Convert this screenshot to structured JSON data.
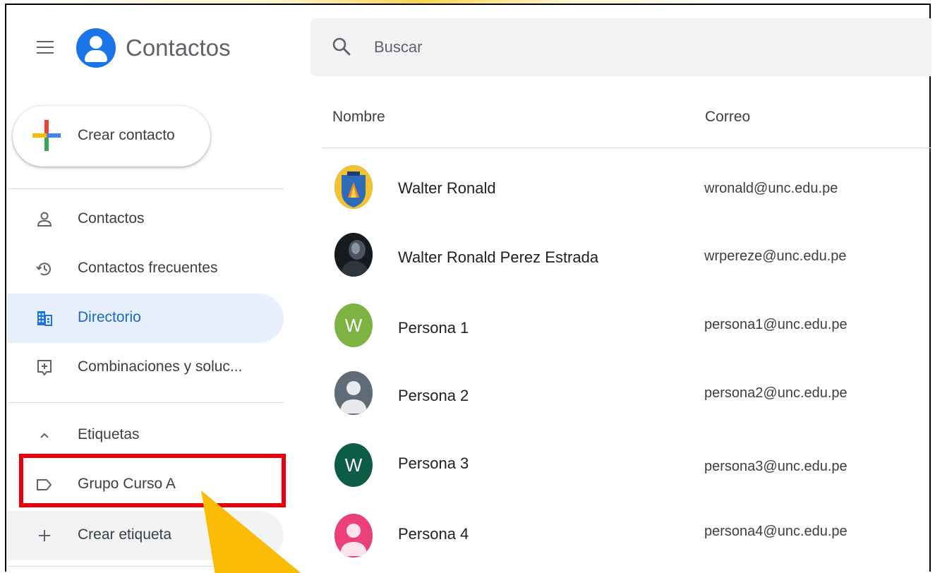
{
  "app": {
    "title": "Contactos"
  },
  "search": {
    "placeholder": "Buscar"
  },
  "create_button": {
    "label": "Crear contacto"
  },
  "sidebar": {
    "items": [
      {
        "label": "Contactos",
        "icon": "person-icon",
        "active": false
      },
      {
        "label": "Contactos frecuentes",
        "icon": "history-icon",
        "active": false
      },
      {
        "label": "Directorio",
        "icon": "domain-icon",
        "active": true
      },
      {
        "label": "Combinaciones y soluc...",
        "icon": "merge-icon",
        "active": false
      }
    ],
    "labels_section": {
      "title": "Etiquetas",
      "icon": "chevron-up-icon"
    },
    "labels": [
      {
        "label": "Grupo Curso A",
        "icon": "label-icon"
      }
    ],
    "create_label": {
      "label": "Crear etiqueta",
      "icon": "plus-icon"
    }
  },
  "table": {
    "columns": {
      "name": "Nombre",
      "email": "Correo"
    },
    "rows": [
      {
        "name": "Walter Ronald",
        "email": "wronald@unc.edu.pe",
        "avatar": "crest-photo"
      },
      {
        "name": "Walter Ronald Perez Estrada",
        "email": "wrpereze@unc.edu.pe",
        "avatar": "dark-photo"
      },
      {
        "name": "Persona 1",
        "email": "persona1@unc.edu.pe",
        "avatar_letter": "W",
        "avatar_color": "#7cb342"
      },
      {
        "name": "Persona 2",
        "email": "persona2@unc.edu.pe",
        "avatar": "default-person",
        "avatar_color": "#5f6b76"
      },
      {
        "name": "Persona 3",
        "email": "persona3@unc.edu.pe",
        "avatar_letter": "W",
        "avatar_color": "#0d5c46"
      },
      {
        "name": "Persona 4",
        "email": "persona4@unc.edu.pe",
        "avatar": "default-person",
        "avatar_color": "#ec407a"
      }
    ]
  },
  "colors": {
    "accent": "#1a73e8",
    "active_bg": "#e8f0fe",
    "highlight_box": "#e8000b",
    "pointer_arrow": "#fbbc05"
  }
}
